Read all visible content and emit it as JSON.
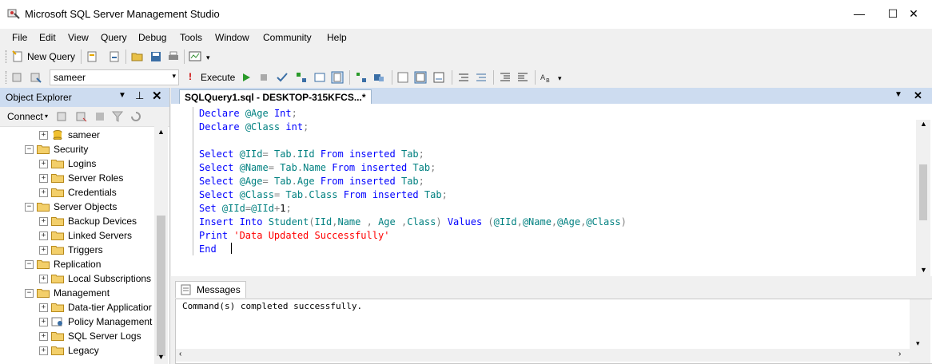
{
  "window": {
    "title": "Microsoft SQL Server Management Studio",
    "minimize": "—",
    "maximize": "☐",
    "close": "✕"
  },
  "menu": [
    "File",
    "Edit",
    "View",
    "Query",
    "Debug",
    "Tools",
    "Window",
    "Community",
    "Help"
  ],
  "toolbar": {
    "new_query": "New Query",
    "database": "sameer",
    "execute": "Execute"
  },
  "object_explorer": {
    "title": "Object Explorer",
    "connect": "Connect",
    "tree": [
      {
        "label": "sameer",
        "expander": "+",
        "indent": 3,
        "icon": "database-icon"
      },
      {
        "label": "Security",
        "expander": "−",
        "indent": 2,
        "icon": "folder-icon"
      },
      {
        "label": "Logins",
        "expander": "+",
        "indent": 3,
        "icon": "folder-icon"
      },
      {
        "label": "Server Roles",
        "expander": "+",
        "indent": 3,
        "icon": "folder-icon"
      },
      {
        "label": "Credentials",
        "expander": "+",
        "indent": 3,
        "icon": "folder-icon"
      },
      {
        "label": "Server Objects",
        "expander": "−",
        "indent": 2,
        "icon": "folder-icon"
      },
      {
        "label": "Backup Devices",
        "expander": "+",
        "indent": 3,
        "icon": "folder-icon"
      },
      {
        "label": "Linked Servers",
        "expander": "+",
        "indent": 3,
        "icon": "folder-icon"
      },
      {
        "label": "Triggers",
        "expander": "+",
        "indent": 3,
        "icon": "folder-icon"
      },
      {
        "label": "Replication",
        "expander": "−",
        "indent": 2,
        "icon": "folder-icon"
      },
      {
        "label": "Local Subscriptions",
        "expander": "+",
        "indent": 3,
        "icon": "folder-icon"
      },
      {
        "label": "Management",
        "expander": "−",
        "indent": 2,
        "icon": "folder-icon"
      },
      {
        "label": "Data-tier Applicatior",
        "expander": "+",
        "indent": 3,
        "icon": "folder-icon"
      },
      {
        "label": "Policy Management",
        "expander": "+",
        "indent": 3,
        "icon": "policy-icon"
      },
      {
        "label": "SQL Server Logs",
        "expander": "+",
        "indent": 3,
        "icon": "folder-icon"
      },
      {
        "label": "Legacy",
        "expander": "+",
        "indent": 3,
        "icon": "folder-icon"
      }
    ]
  },
  "editor": {
    "tab_label": "SQLQuery1.sql - DESKTOP-315KFCS...*",
    "lines": [
      "Declare @Age Int;",
      "Declare @Class int;",
      "",
      "Select @IId= Tab.IId From inserted Tab;",
      "Select @Name= Tab.Name From inserted Tab;",
      "Select @Age= Tab.Age From inserted Tab;",
      "Select @Class= Tab.Class From inserted Tab;",
      "Set @IId=@IId+1;",
      "Insert Into Student(IId,Name , Age ,Class) Values (@IId,@Name,@Age,@Class)",
      "Print 'Data Updated Successfully'",
      "End"
    ]
  },
  "messages": {
    "tab_label": "Messages",
    "text": "Command(s) completed successfully."
  },
  "colors": {
    "keyword": "#0000ff",
    "string": "#ff0000",
    "panel_header": "#cddcf0"
  }
}
